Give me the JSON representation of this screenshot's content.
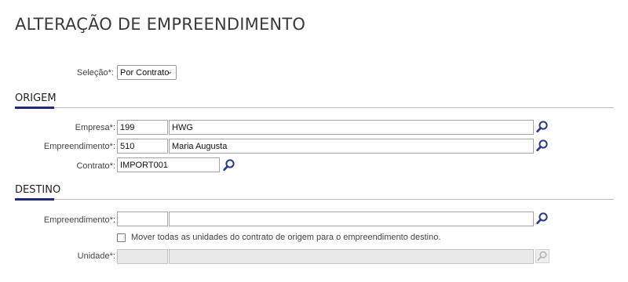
{
  "page": {
    "title": "ALTERAÇÃO DE EMPREENDIMENTO"
  },
  "selecao": {
    "label": "Seleção*:",
    "value": "Por Contrato"
  },
  "origem": {
    "title": "ORIGEM",
    "empresa": {
      "label": "Empresa*:",
      "code": "199",
      "name": "HWG"
    },
    "empreendimento": {
      "label": "Empreendimento*:",
      "code": "510",
      "name": "Maria Augusta"
    },
    "contrato": {
      "label": "Contrato*:",
      "value": "IMPORT001"
    }
  },
  "destino": {
    "title": "DESTINO",
    "empreendimento": {
      "label": "Empreendimento*:",
      "code": "",
      "name": ""
    },
    "mover_todas": {
      "label": "Mover todas as unidades do contrato de origem para o empreendimento destino.",
      "checked": false
    },
    "unidade": {
      "label": "Unidade*:",
      "code": "",
      "name": ""
    }
  },
  "icons": {
    "search": "magnifier-icon",
    "chevron": "chevron-down-icon"
  },
  "colors": {
    "accent": "#1f2a7a",
    "search_icon": "#2b3a8c",
    "search_icon_disabled": "#b5b5b5"
  }
}
